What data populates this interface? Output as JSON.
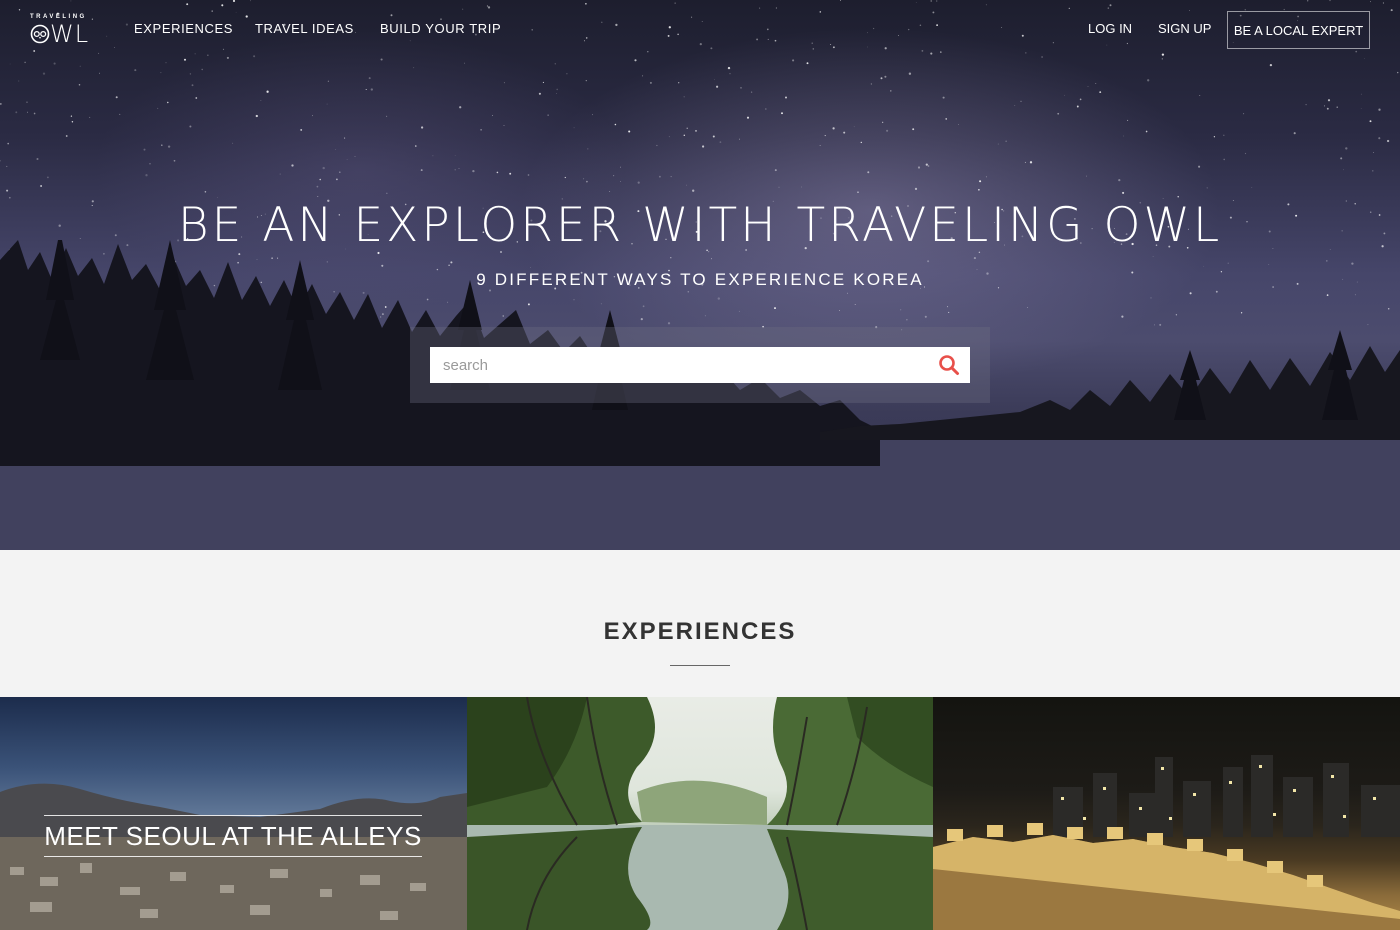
{
  "nav": {
    "logo_small": "TRAVELING",
    "logo_big": "WL",
    "links": [
      "EXPERIENCES",
      "TRAVEL IDEAS",
      "BUILD YOUR TRIP"
    ],
    "login": "LOG IN",
    "signup": "SIGN UP",
    "expert": "BE A LOCAL EXPERT"
  },
  "hero": {
    "title": "BE AN EXPLORER WITH TRAVELING OWL",
    "subtitle": "9 DIFFERENT WAYS TO EXPERIENCE KOREA",
    "search_placeholder": "search",
    "search_icon": "search-icon"
  },
  "experiences": {
    "heading": "EXPERIENCES",
    "tiles": [
      {
        "label": "MEET SEOUL AT THE ALLEYS"
      },
      {
        "label": ""
      },
      {
        "label": ""
      }
    ]
  },
  "colors": {
    "accent": "#e8504a",
    "section_bg": "#f3f3f3",
    "heading": "#333333"
  }
}
